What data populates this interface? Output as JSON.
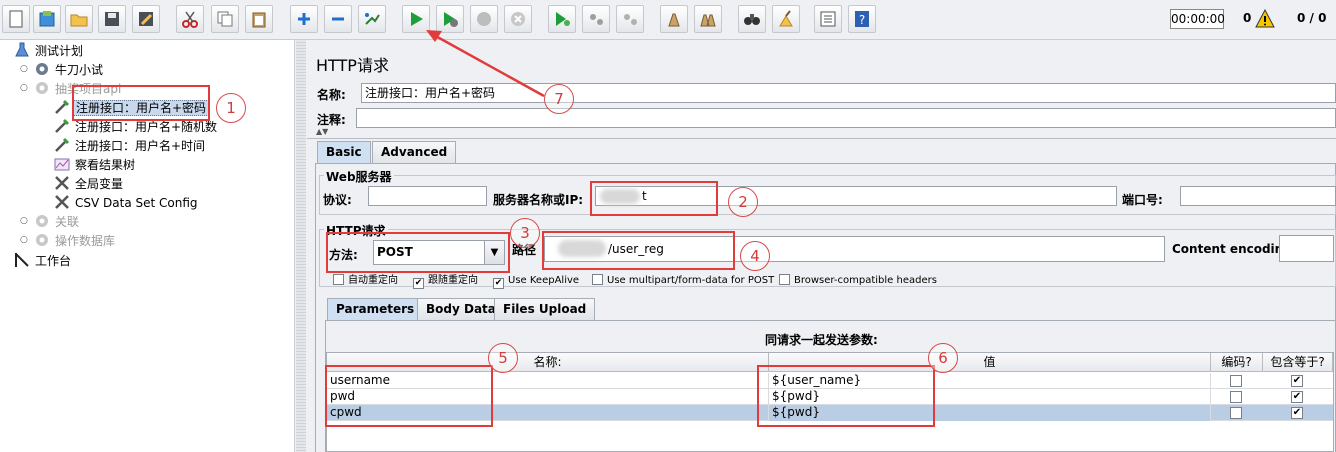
{
  "toolbar": {
    "timer": "00:00:00",
    "warnings_count": "0",
    "threads": "0 / 0",
    "buttons": [
      "new-icon",
      "templates-icon",
      "open-icon",
      "save-icon",
      "save-as-icon",
      "cut-icon",
      "copy-icon",
      "paste-icon",
      "expand-icon",
      "collapse-icon",
      "toggle-icon",
      "start-icon",
      "start-no-pauses-icon",
      "stop-icon",
      "shutdown-icon",
      "remote-start-icon",
      "remote-stop-icon",
      "remote-shutdown-icon",
      "clear-icon",
      "clear-all-icon",
      "search-icon",
      "reset-search-icon",
      "function-helper-icon",
      "help-icon"
    ]
  },
  "tree": {
    "items": [
      {
        "label": "测试计划"
      },
      {
        "label": "牛刀小试"
      },
      {
        "label": "抽奖项目api"
      },
      {
        "label": "注册接口：用户名+密码"
      },
      {
        "label": "注册接口：用户名+随机数"
      },
      {
        "label": "注册接口：用户名+时间"
      },
      {
        "label": "察看结果树"
      },
      {
        "label": "全局变量"
      },
      {
        "label": "CSV Data Set Config"
      },
      {
        "label": "关联"
      },
      {
        "label": "操作数据库"
      },
      {
        "label": "工作台"
      }
    ]
  },
  "panel": {
    "title": "HTTP请求",
    "name_label": "名称:",
    "name_value": "注册接口：用户名+密码",
    "comment_label": "注释:",
    "comment_value": "",
    "tabs": [
      "Basic",
      "Advanced"
    ],
    "web_server": {
      "group_title": "Web服务器",
      "protocol_label": "协议:",
      "protocol_value": "",
      "server_label": "服务器名称或IP:",
      "server_value": "t",
      "port_label": "端口号:",
      "port_value": ""
    },
    "http_request": {
      "group_title": "HTTP请求",
      "method_label": "方法:",
      "method_value": "POST",
      "path_label": "路径",
      "path_value": "/user_reg",
      "encoding_label": "Content encoding:",
      "encoding_value": "",
      "options": [
        {
          "label": "自动重定向",
          "checked": false
        },
        {
          "label": "跟随重定向",
          "checked": true
        },
        {
          "label": "Use KeepAlive",
          "checked": true
        },
        {
          "label": "Use multipart/form-data for POST",
          "checked": false
        },
        {
          "label": "Browser-compatible headers",
          "checked": false
        }
      ]
    },
    "sub_tabs": [
      "Parameters",
      "Body Data",
      "Files Upload"
    ],
    "params": {
      "caption": "同请求一起发送参数:",
      "headers": [
        "名称:",
        "值",
        "编码?",
        "包含等于?"
      ],
      "rows": [
        {
          "name": "username",
          "value": "${user_name}",
          "encode": false,
          "include_equals": true
        },
        {
          "name": "pwd",
          "value": "${pwd}",
          "encode": false,
          "include_equals": true
        },
        {
          "name": "cpwd",
          "value": "${pwd}",
          "encode": false,
          "include_equals": true
        }
      ]
    }
  },
  "annotations": [
    "1",
    "2",
    "3",
    "4",
    "5",
    "6",
    "7"
  ],
  "check_mark": "✔"
}
